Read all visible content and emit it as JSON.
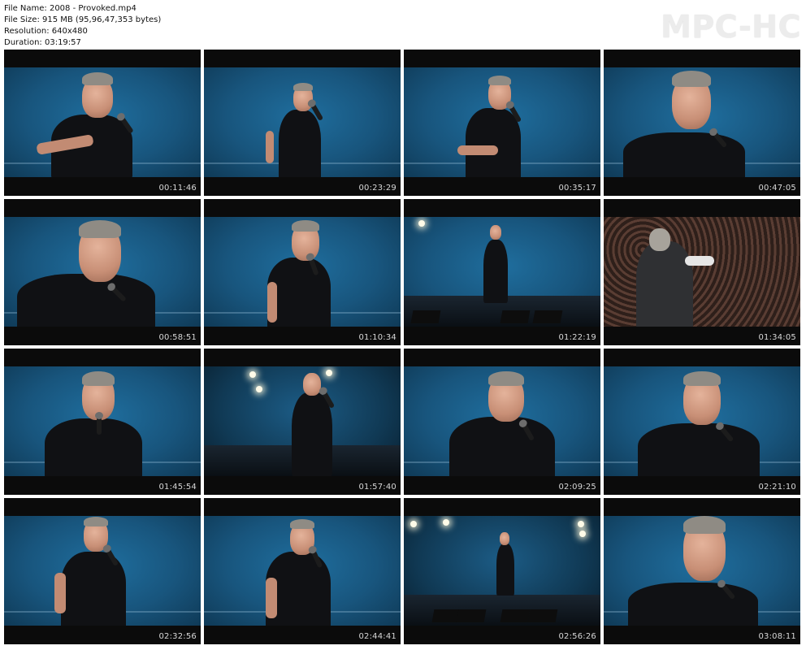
{
  "file_info": {
    "file_name": "File Name: 2008 - Provoked.mp4",
    "file_size": "File Size: 915 MB (95,96,47,353 bytes)",
    "resolution": "Resolution: 640x480",
    "duration": "Duration: 03:19:57"
  },
  "brand": "MPC-HC",
  "thumbnails": [
    {
      "timestamp": "00:11:46"
    },
    {
      "timestamp": "00:23:29"
    },
    {
      "timestamp": "00:35:17"
    },
    {
      "timestamp": "00:47:05"
    },
    {
      "timestamp": "00:58:51"
    },
    {
      "timestamp": "01:10:34"
    },
    {
      "timestamp": "01:22:19"
    },
    {
      "timestamp": "01:34:05"
    },
    {
      "timestamp": "01:45:54"
    },
    {
      "timestamp": "01:57:40"
    },
    {
      "timestamp": "02:09:25"
    },
    {
      "timestamp": "02:21:10"
    },
    {
      "timestamp": "02:32:56"
    },
    {
      "timestamp": "02:44:41"
    },
    {
      "timestamp": "02:56:26"
    },
    {
      "timestamp": "03:08:11"
    }
  ],
  "colors": {
    "stage_blue": "#18557d",
    "letterbox": "#0b0b0b",
    "timestamp_text": "#d8d8d8",
    "brand_text": "#ececec"
  }
}
